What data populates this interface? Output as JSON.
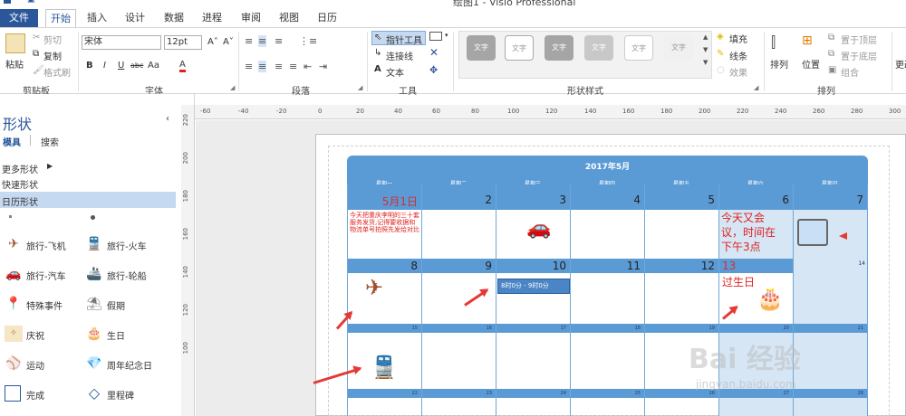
{
  "app": {
    "title": "绘图1 - Visio Professional"
  },
  "tabs": [
    "文件",
    "开始",
    "插入",
    "设计",
    "数据",
    "进程",
    "审阅",
    "视图",
    "日历"
  ],
  "ribbon": {
    "clipboard": {
      "label": "剪贴板",
      "paste": "粘贴",
      "cut": "剪切",
      "copy": "复制",
      "format_painter": "格式刷"
    },
    "font": {
      "label": "字体",
      "name": "宋体",
      "size": "12pt",
      "grow": "A˄",
      "shrink": "A˅",
      "bold": "B",
      "italic": "I",
      "underline": "U",
      "strike": "abc",
      "case": "Aa",
      "color": "A"
    },
    "paragraph": {
      "label": "段落"
    },
    "tools": {
      "label": "工具",
      "pointer": "指针工具",
      "connector": "连接线",
      "text": "文本"
    },
    "shape_styles": {
      "label": "形状样式",
      "tiles": [
        "文字",
        "文字",
        "文字",
        "文字",
        "文字",
        "文字"
      ]
    },
    "shape_format": {
      "fill": "填充",
      "line": "线条",
      "effects": "效果"
    },
    "arrange": {
      "label": "排列",
      "arrange": "排列",
      "position": "位置",
      "bring_front": "置于顶层",
      "send_back": "置于底层",
      "group": "组合"
    },
    "edit": {
      "label": "更改"
    }
  },
  "shapes_pane": {
    "title": "形状",
    "tabs": [
      "模具",
      "搜索"
    ],
    "more": "更多形状",
    "quick": "快速形状",
    "calendar": "日历形状",
    "stencils": [
      {
        "icon": "airplane-icon",
        "label": "旅行-飞机"
      },
      {
        "icon": "train-icon",
        "label": "旅行-火车"
      },
      {
        "icon": "car-icon",
        "label": "旅行-汽车"
      },
      {
        "icon": "ship-icon",
        "label": "旅行-轮船"
      },
      {
        "icon": "pushpin-icon",
        "label": "特殊事件"
      },
      {
        "icon": "vacation-icon",
        "label": "假期"
      },
      {
        "icon": "celebration-icon",
        "label": "庆祝"
      },
      {
        "icon": "birthday-cake-icon",
        "label": "生日"
      },
      {
        "icon": "sports-icon",
        "label": "运动"
      },
      {
        "icon": "diamond-gem-icon",
        "label": "周年纪念日"
      },
      {
        "icon": "square-icon",
        "label": "完成"
      },
      {
        "icon": "diamond-icon",
        "label": "里程碑"
      }
    ]
  },
  "ruler": {
    "h": [
      "-60",
      "-40",
      "-20",
      "0",
      "20",
      "40",
      "60",
      "80",
      "100",
      "120",
      "140",
      "160",
      "180",
      "200",
      "220",
      "240",
      "260",
      "280",
      "300"
    ],
    "v": [
      "220",
      "200",
      "180",
      "160",
      "140",
      "120",
      "100"
    ]
  },
  "calendar": {
    "title": "2017年5月",
    "weekdays": [
      "星期一",
      "星期二",
      "星期三",
      "星期四",
      "星期五",
      "星期六",
      "星期日"
    ],
    "week1": [
      "5月1日",
      "2",
      "3",
      "4",
      "5",
      "6",
      "7"
    ],
    "week2": [
      "8",
      "9",
      "10",
      "11",
      "12",
      "13",
      "14"
    ],
    "week3": [
      "15",
      "16",
      "17",
      "18",
      "19",
      "20",
      "21"
    ],
    "week4": [
      "22",
      "23",
      "24",
      "25",
      "26",
      "27",
      "28"
    ],
    "note_may1": "今天把重庆李明的三十套服务发货,记得要收据和物流单号拍照先发给对比",
    "note_may6": "今天又会议，时间在下午3点",
    "note_may13": "过生日",
    "event_may10": "8时0分 - 9时0分"
  },
  "watermark": {
    "brand": "Bai 经验",
    "url": "jingyan.baidu.com"
  },
  "colors": {
    "accent": "#2b579a",
    "calendar_blue": "#5b9bd5",
    "note_red": "#e02020"
  }
}
